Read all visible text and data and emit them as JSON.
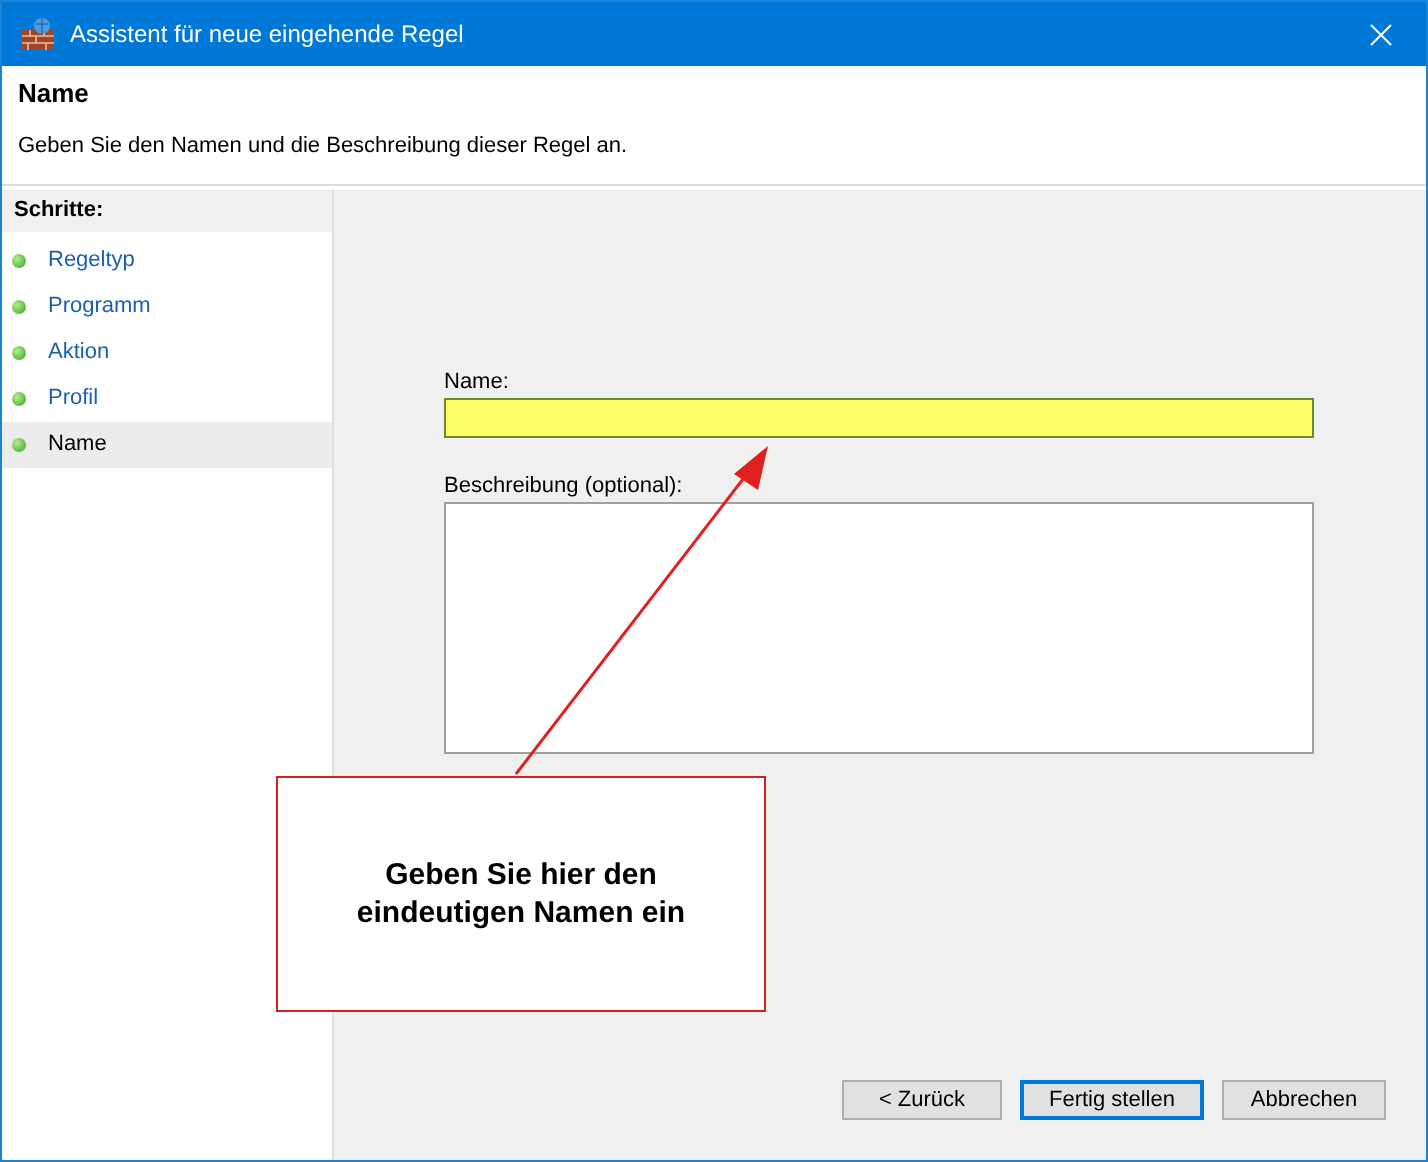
{
  "window": {
    "title": "Assistent für neue eingehende Regel"
  },
  "header": {
    "title": "Name",
    "description": "Geben Sie den Namen und die Beschreibung dieser Regel an."
  },
  "steps": {
    "heading": "Schritte:",
    "items": [
      {
        "label": "Regeltyp",
        "selected": false
      },
      {
        "label": "Programm",
        "selected": false
      },
      {
        "label": "Aktion",
        "selected": false
      },
      {
        "label": "Profil",
        "selected": false
      },
      {
        "label": "Name",
        "selected": true
      }
    ]
  },
  "form": {
    "name_label": "Name:",
    "description_label": "Beschreibung (optional):"
  },
  "annotation": {
    "text": "Geben Sie hier den eindeutigen Namen ein"
  },
  "buttons": [
    {
      "label": "< Zurück",
      "default": false
    },
    {
      "label": "Fertig stellen",
      "default": true
    },
    {
      "label": "Abbrechen",
      "default": false
    }
  ]
}
